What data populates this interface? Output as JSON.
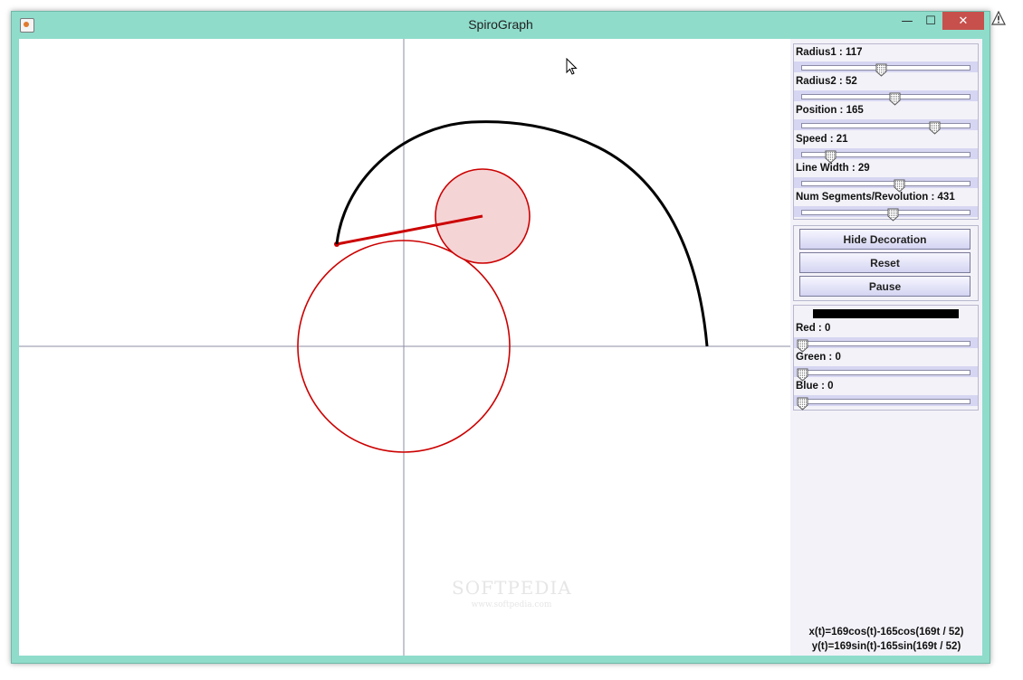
{
  "window": {
    "title": "SpiroGraph"
  },
  "window_controls": {
    "minimize": "—",
    "maximize": "☐",
    "close": "✕"
  },
  "sliders": [
    {
      "label": "Radius1 : 117",
      "level": 0.47
    },
    {
      "label": "Radius2 : 52",
      "level": 0.55
    },
    {
      "label": "Position : 165",
      "level": 0.79
    },
    {
      "label": "Speed : 21",
      "level": 0.17
    },
    {
      "label": "Line Width : 29",
      "level": 0.58
    },
    {
      "label": "Num Segments/Revolution : 431",
      "level": 0.54
    }
  ],
  "buttons": {
    "hide_decoration": "Hide Decoration",
    "reset": "Reset",
    "pause": "Pause"
  },
  "color": {
    "swatch": "#000000",
    "sliders": [
      {
        "label": "Red : 0",
        "level": 0
      },
      {
        "label": "Green : 0",
        "level": 0
      },
      {
        "label": "Blue : 0",
        "level": 0
      }
    ]
  },
  "equations": {
    "x": "x(t)=169cos(t)-165cos(169t / 52)",
    "y": "y(t)=169sin(t)-165sin(169t / 52)"
  },
  "watermark": {
    "name": "SOFTPEDIA",
    "url": "www.softpedia.com"
  },
  "colors": {
    "accent_titlebar": "#8fdccb",
    "decoration_red": "#cc0000",
    "rolling_circle_fill": "#f5d4d6",
    "trace": "#000000",
    "slider_track": "#d6d6f2"
  }
}
